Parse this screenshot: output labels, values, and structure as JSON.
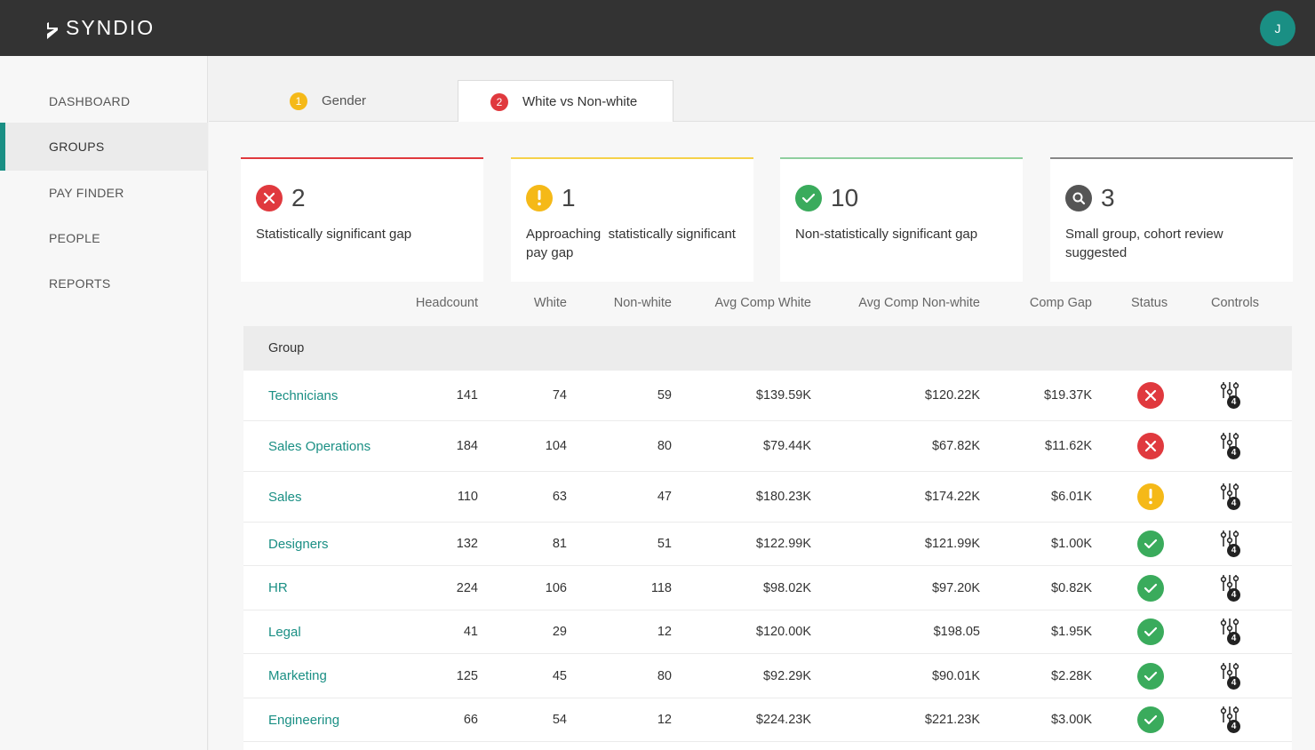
{
  "app": {
    "logo_text": "SYNDIO",
    "avatar_initial": "J"
  },
  "colors": {
    "teal": "#1a8f84",
    "red": "#e0393e",
    "yellow": "#f5b918",
    "green": "#3aab5c",
    "gray": "#555555"
  },
  "sidebar": {
    "items": [
      {
        "label": "DASHBOARD",
        "active": false
      },
      {
        "label": "GROUPS",
        "active": true
      },
      {
        "label": "PAY FINDER",
        "active": false
      },
      {
        "label": "PEOPLE",
        "active": false
      },
      {
        "label": "REPORTS",
        "active": false
      }
    ]
  },
  "tabs": [
    {
      "number": "1",
      "label": "Gender",
      "badge_color": "#f5b918",
      "active": false
    },
    {
      "number": "2",
      "label": "White vs Non-white",
      "badge_color": "#e0393e",
      "active": true
    }
  ],
  "summary": [
    {
      "count": "2",
      "label": "Statistically significant gap",
      "kind": "error-icon",
      "color": "#e0393e"
    },
    {
      "count": "1",
      "label": "Approaching  statistically significant pay gap",
      "kind": "warning-icon",
      "color": "#f5b918"
    },
    {
      "count": "10",
      "label": "Non-statistically significant gap",
      "kind": "check-icon",
      "color": "#3aab5c"
    },
    {
      "count": "3",
      "label": "Small group, cohort review suggested",
      "kind": "search-icon",
      "color": "#555555"
    }
  ],
  "table": {
    "columns": {
      "headcount": "Headcount",
      "white": "White",
      "nonwhite": "Non-white",
      "avg_white": "Avg Comp White",
      "avg_nonwhite": "Avg Comp Non-white",
      "gap": "Comp Gap",
      "status": "Status",
      "controls": "Controls"
    },
    "group_header": "Group",
    "rows": [
      {
        "name": "Technicians",
        "headcount": "141",
        "white": "74",
        "nonwhite": "59",
        "avg_white": "$139.59K",
        "avg_nonwhite": "$120.22K",
        "gap": "$19.37K",
        "status": "error",
        "controls_count": "4"
      },
      {
        "name": "Sales Operations",
        "headcount": "184",
        "white": "104",
        "nonwhite": "80",
        "avg_white": "$79.44K",
        "avg_nonwhite": "$67.82K",
        "gap": "$11.62K",
        "status": "error",
        "controls_count": "4"
      },
      {
        "name": "Sales",
        "headcount": "110",
        "white": "63",
        "nonwhite": "47",
        "avg_white": "$180.23K",
        "avg_nonwhite": "$174.22K",
        "gap": "$6.01K",
        "status": "warning",
        "controls_count": "4"
      },
      {
        "name": "Designers",
        "headcount": "132",
        "white": "81",
        "nonwhite": "51",
        "avg_white": "$122.99K",
        "avg_nonwhite": "$121.99K",
        "gap": "$1.00K",
        "status": "ok",
        "controls_count": "4"
      },
      {
        "name": "HR",
        "headcount": "224",
        "white": "106",
        "nonwhite": "118",
        "avg_white": "$98.02K",
        "avg_nonwhite": "$97.20K",
        "gap": "$0.82K",
        "status": "ok",
        "controls_count": "4"
      },
      {
        "name": "Legal",
        "headcount": "41",
        "white": "29",
        "nonwhite": "12",
        "avg_white": "$120.00K",
        "avg_nonwhite": "$198.05",
        "gap": "$1.95K",
        "status": "ok",
        "controls_count": "4"
      },
      {
        "name": "Marketing",
        "headcount": "125",
        "white": "45",
        "nonwhite": "80",
        "avg_white": "$92.29K",
        "avg_nonwhite": "$90.01K",
        "gap": "$2.28K",
        "status": "ok",
        "controls_count": "4"
      },
      {
        "name": "Engineering",
        "headcount": "66",
        "white": "54",
        "nonwhite": "12",
        "avg_white": "$224.23K",
        "avg_nonwhite": "$221.23K",
        "gap": "$3.00K",
        "status": "ok",
        "controls_count": "4"
      }
    ]
  }
}
